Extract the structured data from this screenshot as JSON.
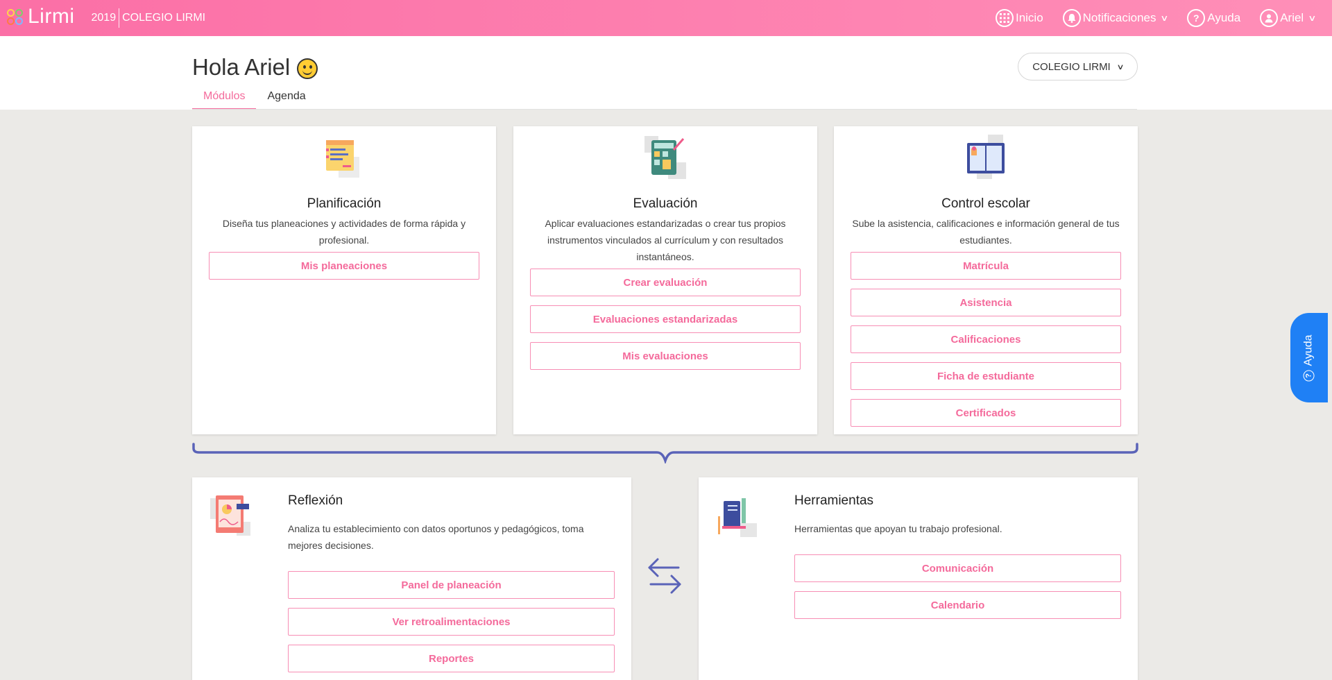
{
  "topbar": {
    "brand": "Lirmi",
    "year": "2019",
    "school": "COLEGIO LIRMI",
    "nav": {
      "inicio": "Inicio",
      "notificaciones": "Notificaciones",
      "ayuda": "Ayuda",
      "user": "Ariel"
    },
    "icons": [
      "grid-icon",
      "bell-icon",
      "question-icon",
      "user-icon",
      "chevron-down-icon"
    ]
  },
  "header": {
    "greeting": "Hola Ariel",
    "tabs": [
      "Módulos",
      "Agenda"
    ],
    "active_tab": "Módulos",
    "school_select": "COLEGIO LIRMI"
  },
  "modules": {
    "planificacion": {
      "title": "Planificación",
      "description": "Diseña tus planeaciones y actividades de forma rápida y profesional.",
      "buttons": [
        "Mis planeaciones"
      ]
    },
    "evaluacion": {
      "title": "Evaluación",
      "description": "Aplicar evaluaciones estandarizadas o crear tus propios instrumentos vinculados al currículum y con resultados instantáneos.",
      "buttons": [
        "Crear evaluación",
        "Evaluaciones estandarizadas",
        "Mis evaluaciones"
      ]
    },
    "control": {
      "title": "Control escolar",
      "description": "Sube la asistencia, calificaciones e información general de tus estudiantes.",
      "buttons": [
        "Matrícula",
        "Asistencia",
        "Calificaciones",
        "Ficha de estudiante",
        "Certificados"
      ]
    },
    "reflexion": {
      "title": "Reflexión",
      "description": "Analiza tu establecimiento con datos oportunos y pedagógicos, toma mejores decisiones.",
      "buttons": [
        "Panel de planeación",
        "Ver retroalimentaciones",
        "Reportes"
      ]
    },
    "herramientas": {
      "title": "Herramientas",
      "description": "Herramientas que apoyan tu trabajo profesional.",
      "buttons": [
        "Comunicación",
        "Calendario"
      ]
    }
  },
  "help_float": {
    "label": "Ayuda"
  },
  "colors": {
    "topbar_start": "#fb6fa6",
    "topbar_end": "#ff8fb8",
    "accent_pink": "#f46a9b",
    "help_blue": "#1f80f5",
    "brace_blue": "#5a63b8"
  }
}
